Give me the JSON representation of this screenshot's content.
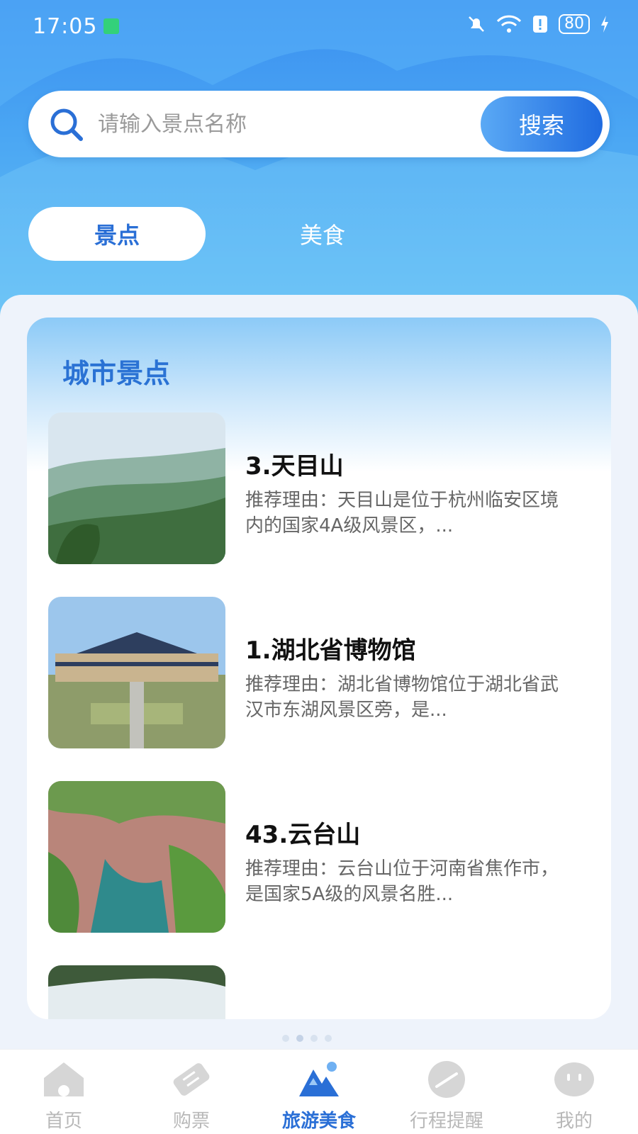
{
  "status_bar": {
    "time": "17:05",
    "battery": "80"
  },
  "search": {
    "placeholder": "请输入景点名称",
    "button": "搜索"
  },
  "tabs": [
    {
      "label": "景点",
      "active": true
    },
    {
      "label": "美食",
      "active": false
    }
  ],
  "section_title": "城市景点",
  "attractions": [
    {
      "title": "3.天目山",
      "desc": "推荐理由：天目山是位于杭州临安区境内的国家4A级风景区，..."
    },
    {
      "title": "1.湖北省博物馆",
      "desc": "推荐理由：湖北省博物馆位于湖北省武汉市东湖风景区旁，是..."
    },
    {
      "title": "43.云台山",
      "desc": "推荐理由：云台山位于河南省焦作市，是国家5A级的风景名胜..."
    }
  ],
  "bottom_nav": [
    {
      "label": "首页",
      "icon": "home-icon",
      "active": false
    },
    {
      "label": "购票",
      "icon": "ticket-icon",
      "active": false
    },
    {
      "label": "旅游美食",
      "icon": "mountain-icon",
      "active": true
    },
    {
      "label": "行程提醒",
      "icon": "reminder-icon",
      "active": false
    },
    {
      "label": "我的",
      "icon": "profile-icon",
      "active": false
    }
  ],
  "colors": {
    "primary": "#2a6fd6",
    "hero_top": "#3a8ef0",
    "inactive_nav": "#b8b8b8"
  }
}
